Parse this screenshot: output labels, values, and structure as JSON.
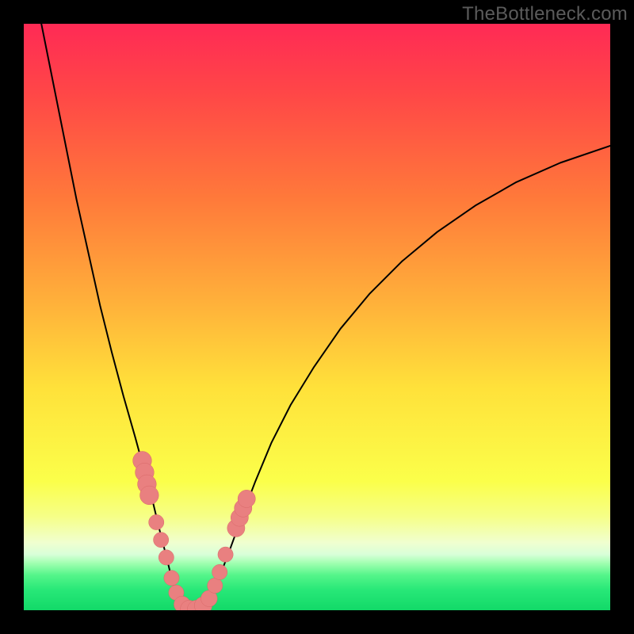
{
  "watermark": "TheBottleneck.com",
  "colors": {
    "black": "#000000",
    "curve": "#000000",
    "marker_fill": "#e98080",
    "marker_stroke": "#d96868"
  },
  "chart_data": {
    "type": "line",
    "title": "",
    "xlabel": "",
    "ylabel": "",
    "xlim": [
      0,
      100
    ],
    "ylim": [
      0,
      100
    ],
    "gradient_stops": [
      {
        "offset": 0.0,
        "color": "#ff2a55"
      },
      {
        "offset": 0.12,
        "color": "#ff4747"
      },
      {
        "offset": 0.3,
        "color": "#ff7a3a"
      },
      {
        "offset": 0.48,
        "color": "#ffb23a"
      },
      {
        "offset": 0.62,
        "color": "#ffe13a"
      },
      {
        "offset": 0.78,
        "color": "#fbff4a"
      },
      {
        "offset": 0.84,
        "color": "#f6ff87"
      },
      {
        "offset": 0.885,
        "color": "#f0ffd0"
      },
      {
        "offset": 0.905,
        "color": "#d8ffd8"
      },
      {
        "offset": 0.92,
        "color": "#a0ffb0"
      },
      {
        "offset": 0.94,
        "color": "#55f58a"
      },
      {
        "offset": 0.965,
        "color": "#28e878"
      },
      {
        "offset": 1.0,
        "color": "#12d968"
      }
    ],
    "series": [
      {
        "name": "left-branch",
        "x": [
          3,
          5,
          7,
          9,
          11,
          13,
          15,
          17,
          19,
          20.5,
          22,
          23.2,
          24.3,
          25.2,
          26,
          26.8
        ],
        "y": [
          100,
          90,
          80,
          70,
          61,
          52,
          44,
          36.5,
          29.5,
          24,
          18.5,
          13.5,
          9.2,
          5.5,
          2.5,
          0.5
        ]
      },
      {
        "name": "valley-floor",
        "x": [
          26.8,
          27.8,
          28.8,
          29.8,
          30.8
        ],
        "y": [
          0.5,
          0.1,
          0.0,
          0.1,
          0.5
        ]
      },
      {
        "name": "right-branch",
        "x": [
          30.8,
          32,
          33.5,
          35.2,
          37.2,
          39.5,
          42.2,
          45.5,
          49.5,
          54,
          59,
          64.5,
          70.5,
          77,
          84,
          91.5,
          100
        ],
        "y": [
          0.5,
          2.5,
          6,
          10.5,
          16,
          22,
          28.5,
          35,
          41.5,
          48,
          54,
          59.5,
          64.5,
          69,
          73,
          76.3,
          79.2
        ]
      }
    ],
    "markers": [
      {
        "x": 20.2,
        "y": 25.5,
        "r": 1.6
      },
      {
        "x": 20.6,
        "y": 23.5,
        "r": 1.6
      },
      {
        "x": 21.0,
        "y": 21.5,
        "r": 1.6
      },
      {
        "x": 21.4,
        "y": 19.6,
        "r": 1.6
      },
      {
        "x": 22.6,
        "y": 15.0,
        "r": 1.3
      },
      {
        "x": 23.4,
        "y": 12.0,
        "r": 1.3
      },
      {
        "x": 24.3,
        "y": 9.0,
        "r": 1.3
      },
      {
        "x": 25.2,
        "y": 5.5,
        "r": 1.3
      },
      {
        "x": 26.0,
        "y": 3.0,
        "r": 1.3
      },
      {
        "x": 27.0,
        "y": 1.0,
        "r": 1.4
      },
      {
        "x": 28.2,
        "y": 0.2,
        "r": 1.5
      },
      {
        "x": 29.4,
        "y": 0.2,
        "r": 1.5
      },
      {
        "x": 30.6,
        "y": 0.8,
        "r": 1.5
      },
      {
        "x": 31.6,
        "y": 2.0,
        "r": 1.4
      },
      {
        "x": 32.6,
        "y": 4.2,
        "r": 1.3
      },
      {
        "x": 33.4,
        "y": 6.5,
        "r": 1.3
      },
      {
        "x": 34.4,
        "y": 9.5,
        "r": 1.3
      },
      {
        "x": 36.2,
        "y": 14.0,
        "r": 1.5
      },
      {
        "x": 36.8,
        "y": 15.8,
        "r": 1.5
      },
      {
        "x": 37.4,
        "y": 17.4,
        "r": 1.5
      },
      {
        "x": 38.0,
        "y": 19.0,
        "r": 1.5
      }
    ]
  }
}
